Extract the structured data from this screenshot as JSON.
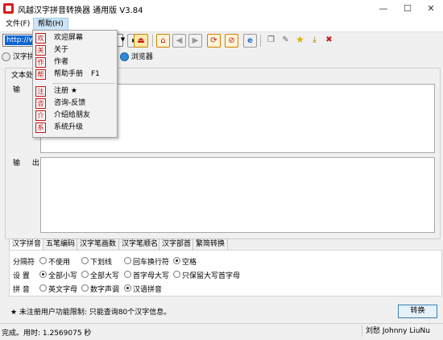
{
  "window": {
    "title": "风越汉字拼音转换器 通用版 V3.84",
    "controls": {
      "minimize": "—",
      "maximize": "☐",
      "close": "✕"
    }
  },
  "menubar": {
    "file": "文件(F)",
    "help": "帮助(H)"
  },
  "help_menu": {
    "items": [
      "欢迎屏幕",
      "关于",
      "作者",
      "帮助手册",
      "注册 ★",
      "咨询-反馈",
      "介绍给朋友",
      "系统升级"
    ],
    "shortcut_help_manual": "F1",
    "icon_glyphs": [
      "欢",
      "关",
      "作",
      "帮",
      "注",
      "咨",
      "介",
      "系"
    ]
  },
  "toolbar": {
    "url_value": "http://ww",
    "icons": [
      "dropdown-arrow",
      "play",
      "stop",
      "home",
      "back",
      "forward",
      "refresh",
      "stop-red",
      "ie-logo",
      "copy",
      "settings",
      "star",
      "arrow-down",
      "close-red"
    ]
  },
  "mode_tabs": {
    "pinyin": "汉字拼",
    "browser": "浏览器"
  },
  "main": {
    "group_title": "文本处",
    "input_label": "输 入",
    "output_label": "输 出",
    "input_value": "",
    "output_value": ""
  },
  "lower_tabs": [
    "汉字拼音",
    "五笔编码",
    "汉字笔画数",
    "汉字笔顺名",
    "汉字部首",
    "繁简转换"
  ],
  "options": {
    "separator": {
      "label": "分隔符",
      "choices": [
        "不使用",
        "下划线",
        "回车换行符",
        "空格"
      ],
      "selected": 3
    },
    "settings": {
      "label": "设 置",
      "choices": [
        "全部小写",
        "全部大写",
        "首字母大写",
        "只保留大写首字母"
      ],
      "selected": 0
    },
    "pinyin": {
      "label": "拼 音",
      "choices": [
        "英文字母",
        "数字声调",
        "汉语拼音"
      ],
      "selected": 2
    }
  },
  "notice": "★ 未注册用户功能限制: 只能查询80个汉字信息。",
  "convert_button": "转换",
  "status": {
    "left": "完成。用时: 1.2569075 秒",
    "right": "刘愁 Johnny LiuNu"
  },
  "colors": {
    "accent": "#0a64d2",
    "brand_red": "#d32020",
    "menu_highlight": "#cce4f7"
  }
}
